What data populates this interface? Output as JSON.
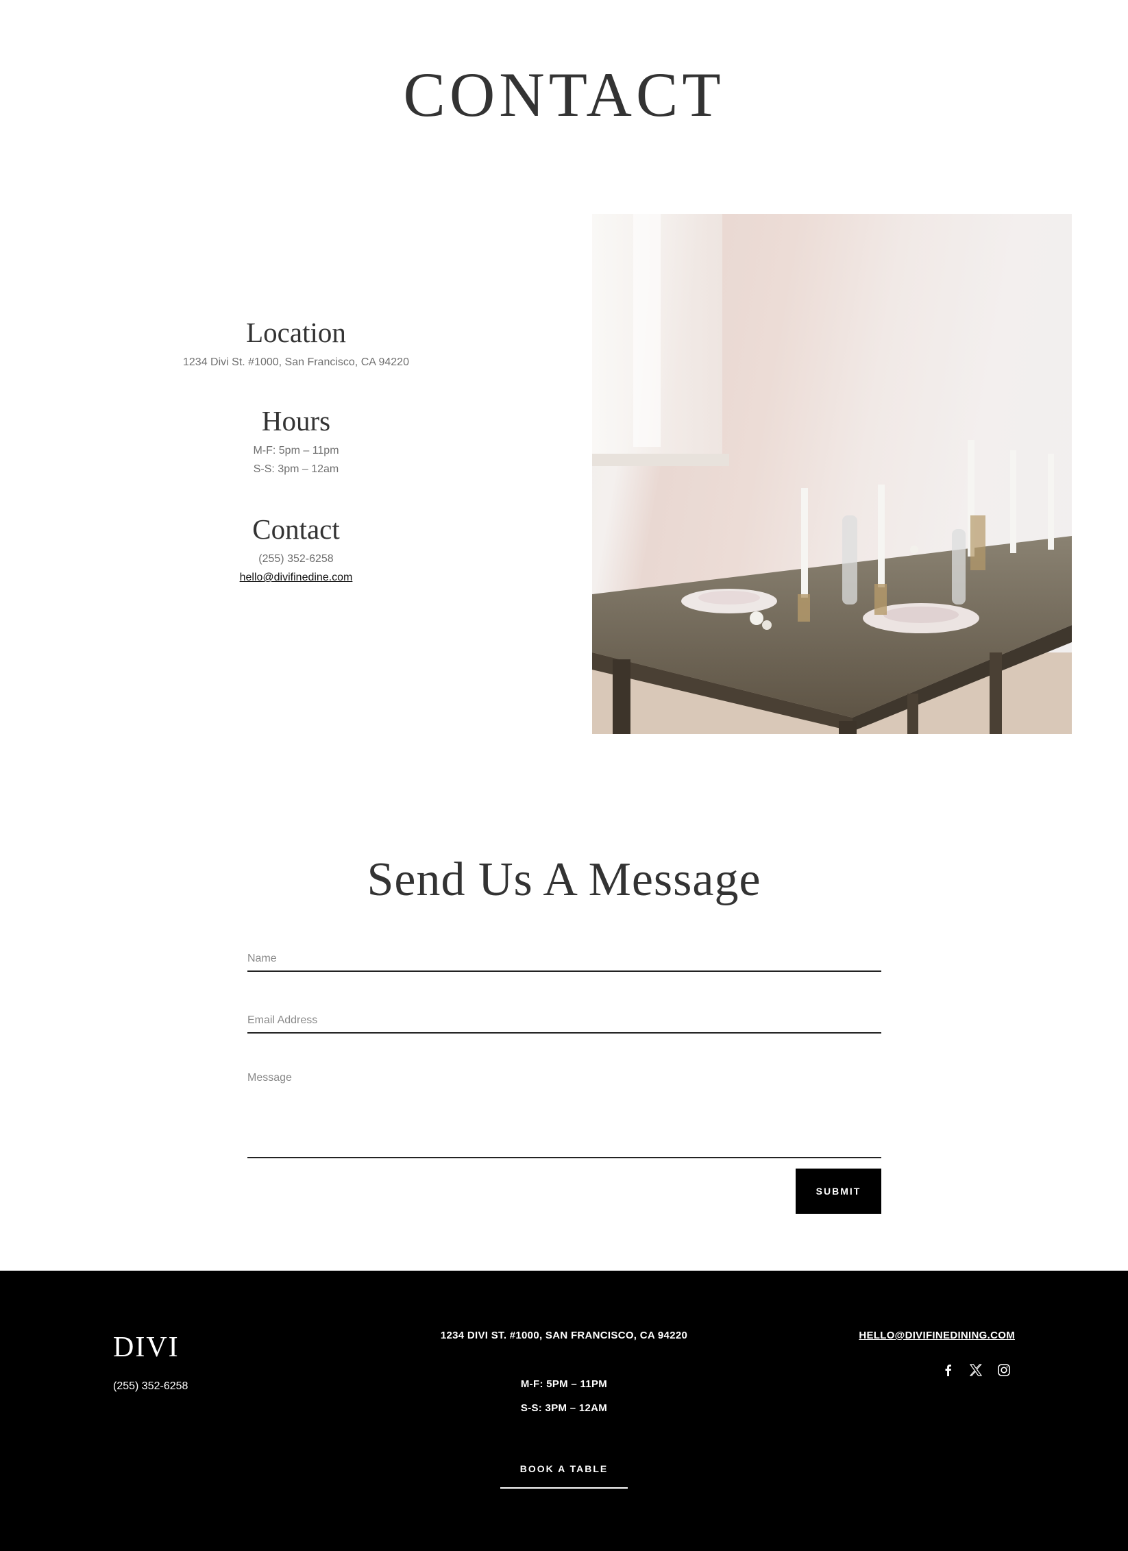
{
  "header": {
    "title": "CONTACT"
  },
  "info": {
    "location": {
      "heading": "Location",
      "address": "1234 Divi St. #1000, San Francisco, CA 94220"
    },
    "hours": {
      "heading": "Hours",
      "weekday": "M-F: 5pm – 11pm",
      "weekend": "S-S: 3pm – 12am"
    },
    "contact": {
      "heading": "Contact",
      "phone": "(255) 352-6258",
      "email": "hello@divifinedine.com"
    }
  },
  "form": {
    "title": "Send Us A Message",
    "name_placeholder": "Name",
    "email_placeholder": "Email Address",
    "message_placeholder": "Message",
    "submit_label": "SUBMIT"
  },
  "footer": {
    "logo": "DIVI",
    "phone": "(255) 352-6258",
    "address": "1234 DIVI ST. #1000, SAN FRANCISCO, CA 94220",
    "hours_weekday": "M-F: 5PM – 11PM",
    "hours_weekend": "S-S: 3PM – 12AM",
    "book_label": "BOOK A TABLE",
    "email": "HELLO@DIVIFINEDINING.COM",
    "social": [
      "facebook-icon",
      "x-icon",
      "instagram-icon"
    ]
  },
  "colors": {
    "text": "#333333",
    "muted": "#6f6f6f",
    "footer_bg": "#000000",
    "button_bg": "#000000"
  }
}
